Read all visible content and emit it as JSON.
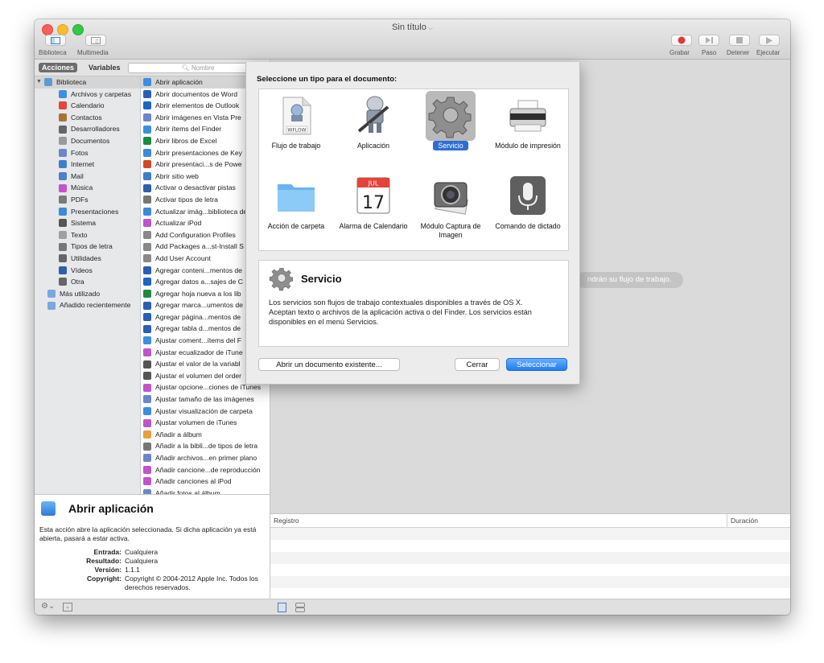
{
  "window": {
    "title": "Sin título"
  },
  "toolbar": {
    "left": [
      {
        "label": "Biblioteca"
      },
      {
        "label": "Multimedia"
      }
    ],
    "right": [
      {
        "label": "Grabar"
      },
      {
        "label": "Paso"
      },
      {
        "label": "Detener"
      },
      {
        "label": "Ejecutar"
      }
    ]
  },
  "scope": {
    "tabs": [
      "Acciones",
      "Variables"
    ],
    "search_placeholder": "Nombre"
  },
  "library": [
    {
      "label": "Biblioteca",
      "icon": "library-icon",
      "color": "#5b9bd5"
    },
    {
      "label": "Archivos y carpetas",
      "icon": "finder-icon",
      "color": "#3b8fe0"
    },
    {
      "label": "Calendario",
      "icon": "calendar-icon",
      "color": "#e0473c"
    },
    {
      "label": "Contactos",
      "icon": "contacts-icon",
      "color": "#a7733a"
    },
    {
      "label": "Desarrolladores",
      "icon": "tools-icon",
      "color": "#666666"
    },
    {
      "label": "Documentos",
      "icon": "document-icon",
      "color": "#9a9a9a"
    },
    {
      "label": "Fotos",
      "icon": "photos-icon",
      "color": "#6a88c8"
    },
    {
      "label": "Internet",
      "icon": "globe-icon",
      "color": "#3c7fc7"
    },
    {
      "label": "Mail",
      "icon": "mail-icon",
      "color": "#4b7fcf"
    },
    {
      "label": "Música",
      "icon": "music-icon",
      "color": "#c254c9"
    },
    {
      "label": "PDFs",
      "icon": "pdf-icon",
      "color": "#7a7a7a"
    },
    {
      "label": "Presentaciones",
      "icon": "presentation-icon",
      "color": "#3d8ad8"
    },
    {
      "label": "Sistema",
      "icon": "system-icon",
      "color": "#555555"
    },
    {
      "label": "Texto",
      "icon": "text-icon",
      "color": "#a0a0a0"
    },
    {
      "label": "Tipos de letra",
      "icon": "font-icon",
      "color": "#777777"
    },
    {
      "label": "Utilidades",
      "icon": "tools-icon",
      "color": "#666666"
    },
    {
      "label": "Vídeos",
      "icon": "video-icon",
      "color": "#2f5fa7"
    },
    {
      "label": "Otra",
      "icon": "tools-icon",
      "color": "#666666"
    },
    {
      "label": "Más utilizado",
      "icon": "smart-folder-icon",
      "color": "#7ba7de"
    },
    {
      "label": "Añadido recientemente",
      "icon": "smart-folder-icon",
      "color": "#7ba7de"
    }
  ],
  "actions": [
    {
      "label": "Abrir aplicación",
      "color": "#3b8fe0"
    },
    {
      "label": "Abrir documentos de Word",
      "color": "#2b5fb4"
    },
    {
      "label": "Abrir elementos de Outlook",
      "color": "#1c66c4"
    },
    {
      "label": "Abrir imágenes en Vista Pre",
      "color": "#6a88c8"
    },
    {
      "label": "Abrir ítems del Finder",
      "color": "#3b8fe0"
    },
    {
      "label": "Abrir libros de Excel",
      "color": "#1f8a3f"
    },
    {
      "label": "Abrir presentaciones de Key",
      "color": "#3d8ad8"
    },
    {
      "label": "Abrir presentaci...s de Powe",
      "color": "#d24726"
    },
    {
      "label": "Abrir sitio web",
      "color": "#3c7fc7"
    },
    {
      "label": "Activar o desactivar pistas",
      "color": "#2f5fa7"
    },
    {
      "label": "Activar tipos de letra",
      "color": "#777777"
    },
    {
      "label": "Actualizar imág...biblioteca de",
      "color": "#3d8ad8"
    },
    {
      "label": "Actualizar iPod",
      "color": "#c254c9"
    },
    {
      "label": "Add Configuration Profiles",
      "color": "#888888"
    },
    {
      "label": "Add Packages a...st-Install S",
      "color": "#888888"
    },
    {
      "label": "Add User Account",
      "color": "#888888"
    },
    {
      "label": "Agregar conteni...mentos de",
      "color": "#2b5fb4"
    },
    {
      "label": "Agregar datos a...sajes de C",
      "color": "#1c66c4"
    },
    {
      "label": "Agregar hoja nueva a los lib",
      "color": "#1f8a3f"
    },
    {
      "label": "Agregar marca...umentos de",
      "color": "#2b5fb4"
    },
    {
      "label": "Agregar página...mentos de",
      "color": "#2b5fb4"
    },
    {
      "label": "Agregar tabla d...mentos de",
      "color": "#2b5fb4"
    },
    {
      "label": "Ajustar coment...ítems del F",
      "color": "#3b8fe0"
    },
    {
      "label": "Ajustar ecualizador de iTune",
      "color": "#c254c9"
    },
    {
      "label": "Ajustar el valor de la variabl",
      "color": "#555555"
    },
    {
      "label": "Ajustar el volumen del order",
      "color": "#555555"
    },
    {
      "label": "Ajustar opcione...ciones de iTunes",
      "color": "#c254c9"
    },
    {
      "label": "Ajustar tamaño de las imágenes",
      "color": "#6a88c8"
    },
    {
      "label": "Ajustar visualización de carpeta",
      "color": "#3b8fe0"
    },
    {
      "label": "Ajustar volumen de iTunes",
      "color": "#c254c9"
    },
    {
      "label": "Añadir a álbum",
      "color": "#e8a13a"
    },
    {
      "label": "Añadir a la bibli...de tipos de letra",
      "color": "#777777"
    },
    {
      "label": "Añadir archivos...en primer plano",
      "color": "#6a88c8"
    },
    {
      "label": "Añadir cancione...de reproducción",
      "color": "#c254c9"
    },
    {
      "label": "Añadir canciones al iPod",
      "color": "#c254c9"
    },
    {
      "label": "Añadir fotos al álbum",
      "color": "#6a88c8"
    }
  ],
  "description": {
    "title": "Abrir aplicación",
    "text": "Esta acción abre la aplicación seleccionada. Si dicha aplicación ya está abierta, pasará a estar activa.",
    "fields": [
      {
        "key": "Entrada:",
        "value": "Cualquiera"
      },
      {
        "key": "Resultado:",
        "value": "Cualquiera"
      },
      {
        "key": "Versión:",
        "value": "1.1.1"
      },
      {
        "key": "Copyright:",
        "value": "Copyright © 2004-2012 Apple Inc. Todos los derechos reservados."
      }
    ]
  },
  "canvas": {
    "hint": "ndrán su flujo de trabajo."
  },
  "log": {
    "col_registro": "Registro",
    "col_duracion": "Duración"
  },
  "sheet": {
    "title": "Seleccione un tipo para el documento:",
    "types": [
      {
        "label": "Flujo de trabajo",
        "icon": "workflow-icon",
        "badge": "WFLOW"
      },
      {
        "label": "Aplicación",
        "icon": "automator-robot-icon"
      },
      {
        "label": "Servicio",
        "icon": "gear-icon"
      },
      {
        "label": "Módulo de impresión",
        "icon": "printer-icon"
      },
      {
        "label": "Acción de carpeta",
        "icon": "folder-icon"
      },
      {
        "label": "Alarma de Calendario",
        "icon": "calendar-icon",
        "month": "JUL",
        "day": "17"
      },
      {
        "label": "Módulo Captura de Imagen",
        "icon": "camera-icon"
      },
      {
        "label": "Comando de dictado",
        "icon": "microphone-icon"
      }
    ],
    "info_title": "Servicio",
    "info_text": "Los servicios son flujos de trabajo contextuales disponibles a través de OS X. Aceptan texto o archivos de la aplicación activa o del Finder. Los servicios están disponibles en el menú Servicios.",
    "btn_open": "Abrir un documento existente...",
    "btn_close": "Cerrar",
    "btn_select": "Seleccionar"
  }
}
